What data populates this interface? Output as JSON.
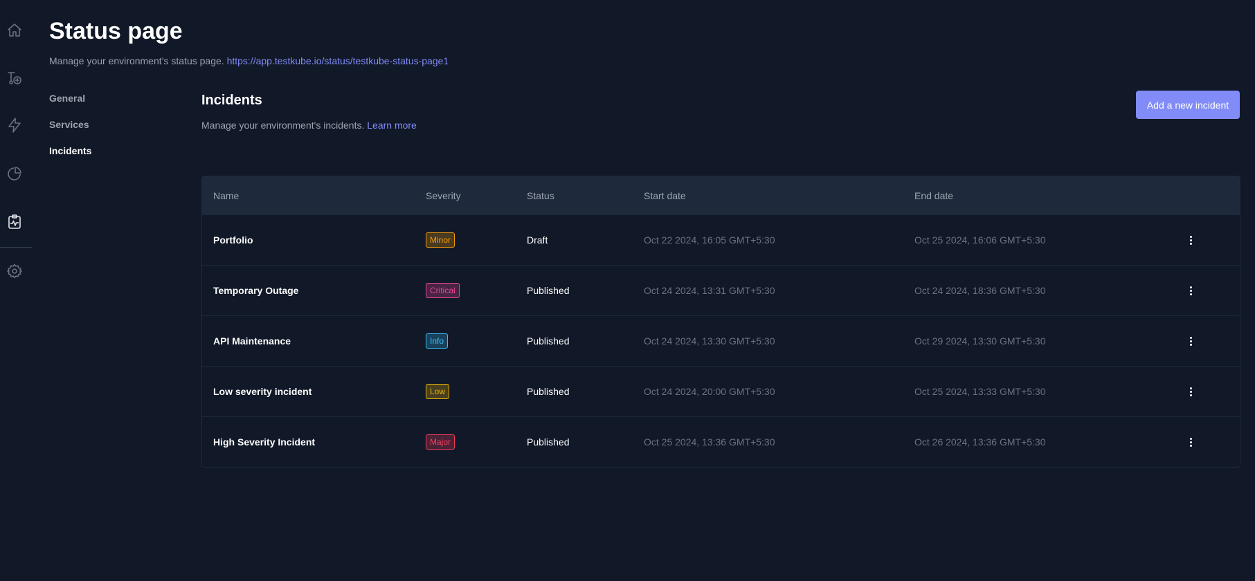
{
  "rail": {
    "icons": [
      "home-icon",
      "add-workflow-icon",
      "lightning-icon",
      "pie-chart-icon",
      "status-page-icon",
      "settings-icon"
    ]
  },
  "header": {
    "title": "Status page",
    "subtitle_prefix": "Manage your environment’s status page.",
    "url": "https://app.testkube.io/status/testkube-status-page1"
  },
  "settings_nav": {
    "items": [
      {
        "label": "General"
      },
      {
        "label": "Services"
      },
      {
        "label": "Incidents"
      }
    ],
    "active": "Incidents"
  },
  "incidents": {
    "title": "Incidents",
    "description": "Manage your environment's incidents.",
    "learn_more": "Learn more",
    "add_button": "Add a new incident",
    "columns": [
      "Name",
      "Severity",
      "Status",
      "Start date",
      "End date"
    ],
    "rows": [
      {
        "name": "Portfolio",
        "severity": "Minor",
        "severity_color": "#f59e0b",
        "status": "Draft",
        "start": "Oct 22 2024, 16:05 GMT+5:30",
        "end": "Oct 25 2024, 16:06 GMT+5:30"
      },
      {
        "name": "Temporary Outage",
        "severity": "Critical",
        "severity_color": "#ec4899",
        "status": "Published",
        "start": "Oct 24 2024, 13:31 GMT+5:30",
        "end": "Oct 24 2024, 18:36 GMT+5:30"
      },
      {
        "name": "API Maintenance",
        "severity": "Info",
        "severity_color": "#38bdf8",
        "status": "Published",
        "start": "Oct 24 2024, 13:30 GMT+5:30",
        "end": "Oct 29 2024, 13:30 GMT+5:30"
      },
      {
        "name": "Low severity incident",
        "severity": "Low",
        "severity_color": "#eab308",
        "status": "Published",
        "start": "Oct 24 2024, 20:00 GMT+5:30",
        "end": "Oct 25 2024, 13:33 GMT+5:30"
      },
      {
        "name": "High Severity Incident",
        "severity": "Major",
        "severity_color": "#f43f5e",
        "status": "Published",
        "start": "Oct 25 2024, 13:36 GMT+5:30",
        "end": "Oct 26 2024, 13:36 GMT+5:30"
      }
    ]
  },
  "colors": {
    "background": "#111827",
    "accent": "#818cf8",
    "table_header": "#1e293b"
  }
}
